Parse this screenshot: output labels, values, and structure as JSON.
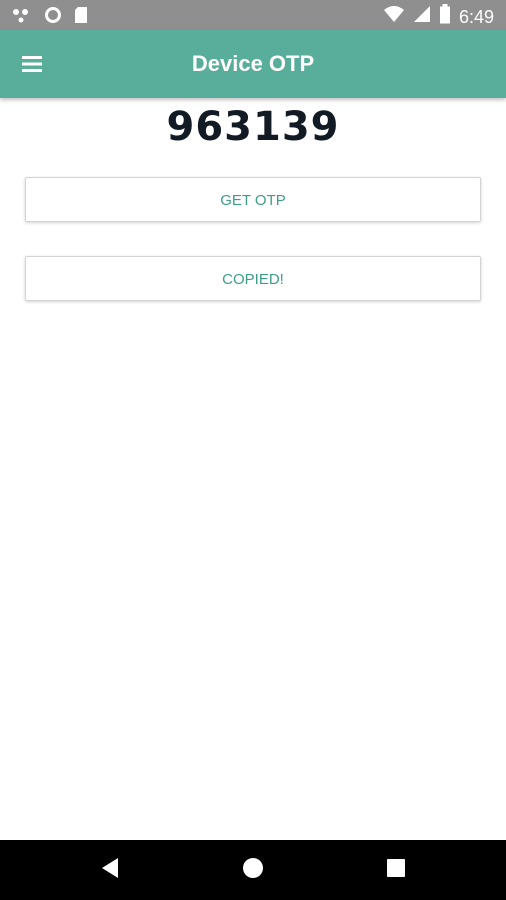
{
  "status_bar": {
    "time": "6:49",
    "left_icons": [
      "notification-dots-icon",
      "circle-icon",
      "sd-card-icon"
    ],
    "right_icons": [
      "wifi-icon",
      "signal-icon",
      "battery-icon"
    ]
  },
  "app_bar": {
    "title": "Device OTP",
    "menu_icon": "menu-icon",
    "color": "#59ad9b"
  },
  "otp": {
    "code": "963139"
  },
  "buttons": {
    "get_otp": "GET OTP",
    "copied": "COPIED!",
    "text_color": "#3d9d8a"
  },
  "nav_bar": {
    "items": [
      "back-icon",
      "home-icon",
      "recents-icon"
    ]
  }
}
